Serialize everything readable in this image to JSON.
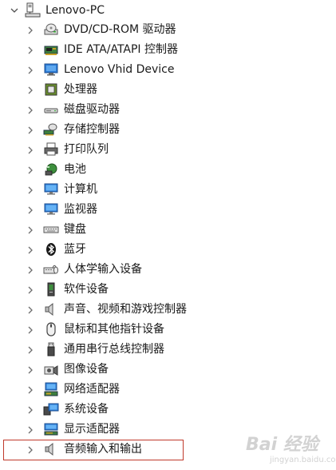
{
  "root": {
    "label": "Lenovo-PC",
    "expanded": true,
    "icon": "computer-icon"
  },
  "devices": [
    {
      "label": "DVD/CD-ROM 驱动器",
      "icon": "dvd-drive-icon"
    },
    {
      "label": "IDE ATA/ATAPI 控制器",
      "icon": "ide-controller-icon"
    },
    {
      "label": "Lenovo Vhid Device",
      "icon": "vhid-device-icon"
    },
    {
      "label": "处理器",
      "icon": "processor-icon"
    },
    {
      "label": "磁盘驱动器",
      "icon": "disk-drive-icon"
    },
    {
      "label": "存储控制器",
      "icon": "storage-controller-icon"
    },
    {
      "label": "打印队列",
      "icon": "printer-icon"
    },
    {
      "label": "电池",
      "icon": "battery-icon"
    },
    {
      "label": "计算机",
      "icon": "computer-monitor-icon"
    },
    {
      "label": "监视器",
      "icon": "monitor-icon"
    },
    {
      "label": "键盘",
      "icon": "keyboard-icon"
    },
    {
      "label": "蓝牙",
      "icon": "bluetooth-icon"
    },
    {
      "label": "人体学输入设备",
      "icon": "hid-icon"
    },
    {
      "label": "软件设备",
      "icon": "software-device-icon"
    },
    {
      "label": "声音、视频和游戏控制器",
      "icon": "speaker-icon"
    },
    {
      "label": "鼠标和其他指针设备",
      "icon": "mouse-icon"
    },
    {
      "label": "通用串行总线控制器",
      "icon": "usb-icon"
    },
    {
      "label": "图像设备",
      "icon": "camera-icon"
    },
    {
      "label": "网络适配器",
      "icon": "network-adapter-icon"
    },
    {
      "label": "系统设备",
      "icon": "system-device-icon"
    },
    {
      "label": "显示适配器",
      "icon": "display-adapter-icon"
    },
    {
      "label": "音频输入和输出",
      "icon": "audio-io-icon",
      "highlighted": true
    }
  ],
  "watermark": {
    "main": "Bai 经验",
    "sub": "jingyan.baidu.com"
  },
  "colors": {
    "highlight_border": "#c0392b",
    "chevron": "#6d6d6d",
    "monitor_blue": "#2b7bd6"
  }
}
